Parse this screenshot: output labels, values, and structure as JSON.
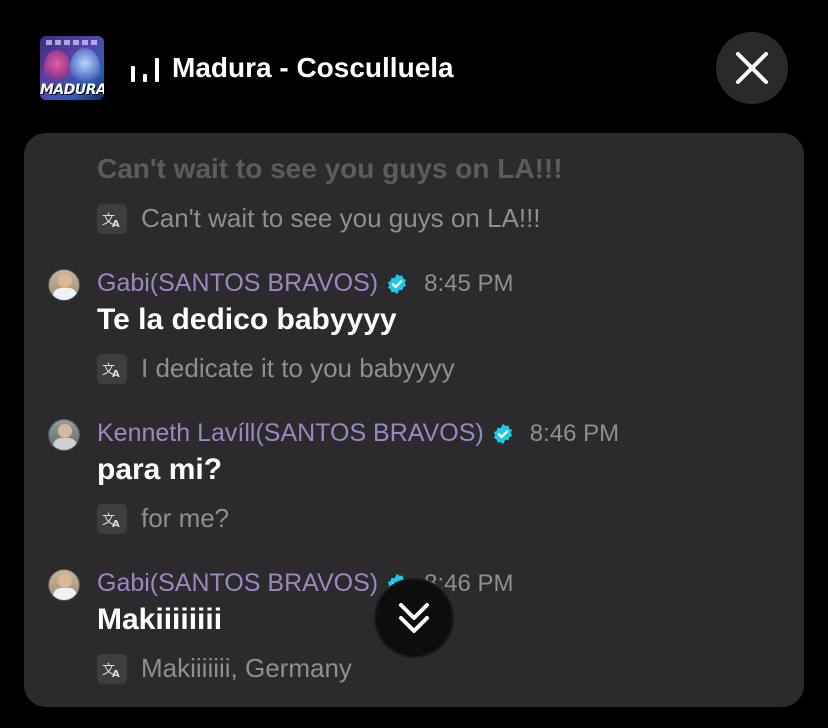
{
  "header": {
    "album_art_text": "MADURA",
    "song_title": "Madura - Cosculluela"
  },
  "colors": {
    "author": "#9f86c0",
    "verified": "#1ec8e6",
    "panel": "#2b2b2d"
  },
  "chat": {
    "faded_message": "Can't wait to see you guys on LA!!!",
    "faded_translation": "Can't wait to see you guys on LA!!!",
    "messages": [
      {
        "author": "Gabi(SANTOS BRAVOS)",
        "time": "8:45 PM",
        "text": "Te la dedico babyyyy",
        "translation": "I dedicate it to you babyyyy"
      },
      {
        "author": "Kenneth Lavíll(SANTOS BRAVOS)",
        "time": "8:46 PM",
        "text": "para mi?",
        "translation": "for me?"
      },
      {
        "author": "Gabi(SANTOS BRAVOS)",
        "time": "8:46 PM",
        "text": "Makiiiiiiii",
        "translation": "Makiiiiiii, Germany"
      }
    ]
  },
  "icons": {
    "close": "close-icon",
    "scroll": "double-chevron-down-icon",
    "translate": "translate-icon",
    "verified": "verified-badge-icon",
    "now_playing": "equalizer-icon"
  }
}
